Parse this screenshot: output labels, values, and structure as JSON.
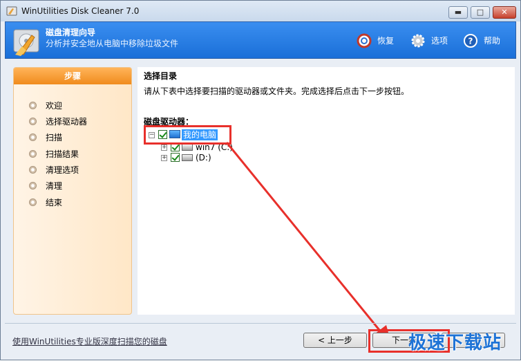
{
  "window": {
    "title": "WinUtilities Disk Cleaner 7.0",
    "minimize_symbol": "▬",
    "maximize_symbol": "□",
    "close_symbol": "✕"
  },
  "header": {
    "title": "磁盘清理向导",
    "subtitle": "分析并安全地从电脑中移除垃圾文件",
    "actions": [
      {
        "label": "恢复",
        "icon": "restore-icon"
      },
      {
        "label": "选项",
        "icon": "gear-icon"
      },
      {
        "label": "帮助",
        "icon": "help-icon"
      }
    ]
  },
  "sidebar": {
    "title": "步骤",
    "steps": [
      "欢迎",
      "选择驱动器",
      "扫描",
      "扫描结果",
      "清理选项",
      "清理",
      "结束"
    ]
  },
  "main": {
    "section_title": "选择目录",
    "description": "请从下表中选择要扫描的驱动器或文件夹。完成选择后点击下一步按钮。",
    "drives_label": "磁盘驱动器：",
    "tree": {
      "root": {
        "label": "我的电脑",
        "checked": true,
        "expanded": true,
        "selected": true
      },
      "children": [
        {
          "label": "win7 (C:)",
          "checked": true
        },
        {
          "label": "(D:)",
          "checked": true
        }
      ]
    }
  },
  "footer": {
    "link_text": "使用WinUtilities专业版深度扫描您的磁盘",
    "back_button": "< 上一步",
    "next_button": "下一步",
    "cancel_button": "取消"
  },
  "watermark": "极速下载站",
  "colors": {
    "header_blue": "#1a6fd8",
    "sidebar_orange": "#f08b1d",
    "highlight_red": "#e8302b",
    "selection_blue": "#3399ff"
  }
}
